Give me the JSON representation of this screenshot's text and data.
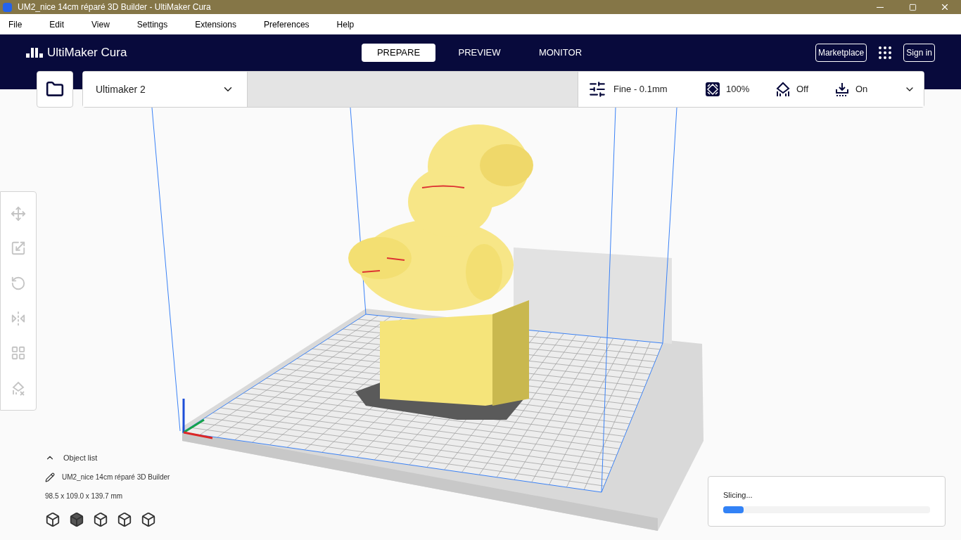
{
  "window": {
    "title": "UM2_nice 14cm réparé 3D Builder - UltiMaker Cura"
  },
  "menu": [
    "File",
    "Edit",
    "View",
    "Settings",
    "Extensions",
    "Preferences",
    "Help"
  ],
  "header": {
    "logo": "UltiMaker Cura",
    "stages": [
      {
        "label": "PREPARE",
        "selected": true
      },
      {
        "label": "PREVIEW",
        "selected": false
      },
      {
        "label": "MONITOR",
        "selected": false
      }
    ],
    "marketplace": "Marketplace",
    "sign_in": "Sign in"
  },
  "printer": {
    "name": "Ultimaker 2"
  },
  "print_settings": {
    "profile": "Fine - 0.1mm",
    "infill": "100%",
    "support": "Off",
    "adhesion": "On"
  },
  "object_list": {
    "title": "Object list",
    "expanded": true,
    "object": "UM2_nice 14cm réparé 3D Builder",
    "dimensions": "98.5 x 109.0 x 139.7 mm"
  },
  "slicing": {
    "label": "Slicing...",
    "level": 0.1
  }
}
